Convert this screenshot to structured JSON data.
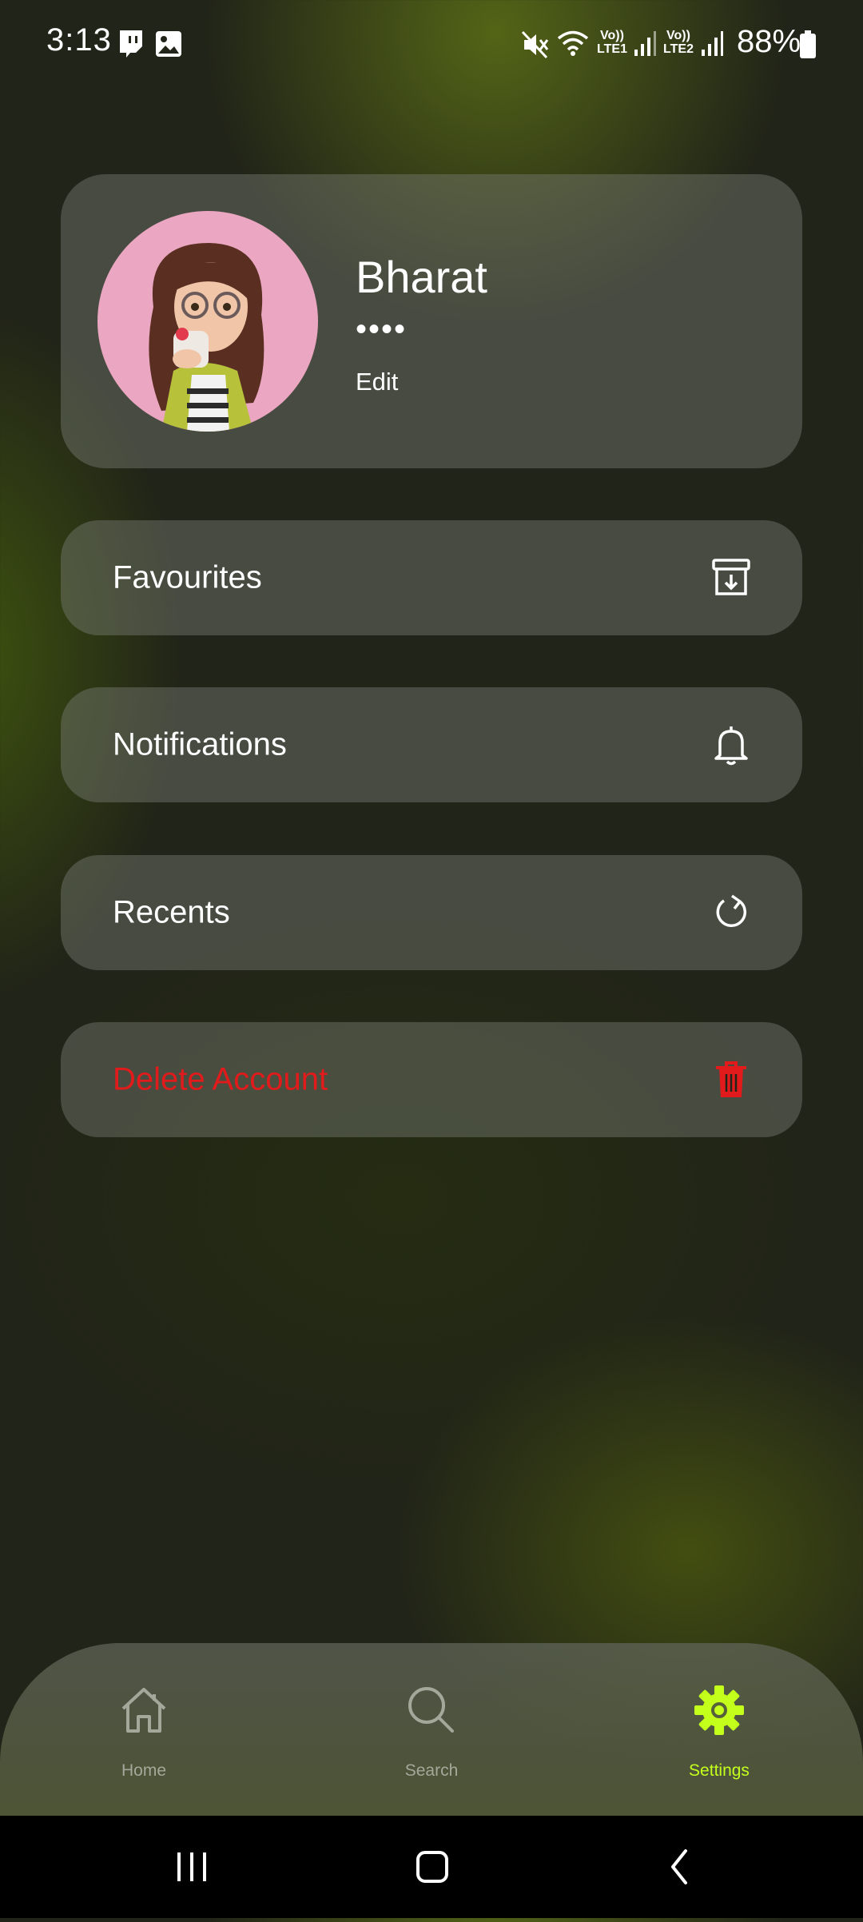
{
  "status_bar": {
    "time": "3:13",
    "battery": "88%",
    "lte1": "LTE1",
    "lte2": "LTE2",
    "volte": "Vo))",
    "icons": [
      "twitch-icon",
      "gallery-icon",
      "mute-icon",
      "wifi-icon",
      "signal-icon",
      "battery-icon"
    ]
  },
  "profile": {
    "name": "Bharat",
    "masked": "••••",
    "edit_label": "Edit"
  },
  "menu": [
    {
      "label": "Favourites",
      "icon": "archive-icon"
    },
    {
      "label": "Notifications",
      "icon": "bell-icon"
    },
    {
      "label": "Recents",
      "icon": "refresh-icon"
    },
    {
      "label": "Delete Account",
      "icon": "trash-icon"
    }
  ],
  "bottom_nav": {
    "items": [
      {
        "label": "Home",
        "icon": "home-icon"
      },
      {
        "label": "Search",
        "icon": "search-icon"
      },
      {
        "label": "Settings",
        "icon": "gear-icon",
        "active": true
      }
    ]
  },
  "system_nav": [
    "recents-button",
    "home-button",
    "back-button"
  ],
  "colors": {
    "accent": "#c4ff1c",
    "danger": "#e11b1b",
    "avatar_bg": "#eba6c1"
  }
}
